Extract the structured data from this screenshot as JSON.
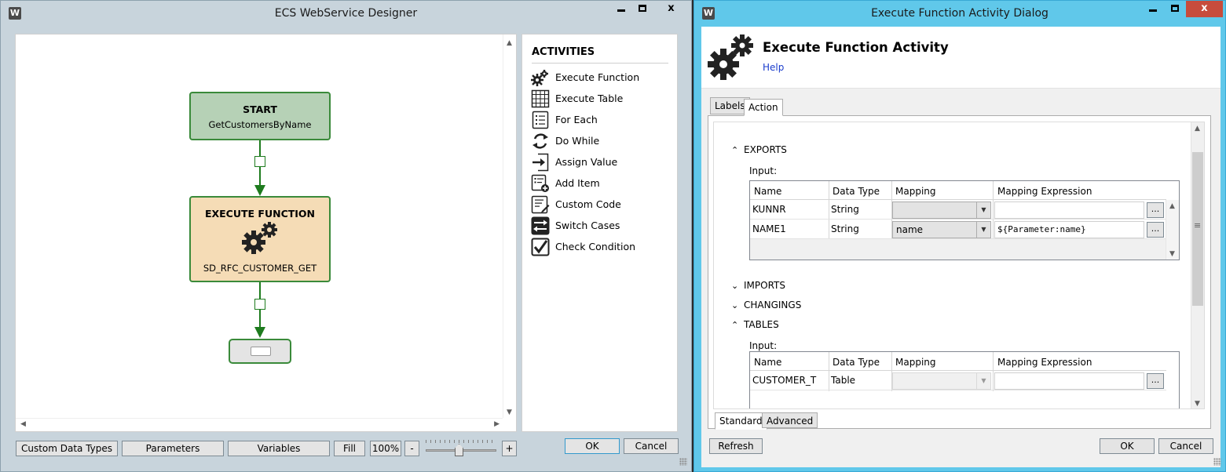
{
  "designer": {
    "title": "ECS WebService Designer",
    "app_icon": "W",
    "caption": {
      "min": "",
      "max": "",
      "close": "x"
    },
    "nodes": {
      "start": {
        "title": "START",
        "subtitle": "GetCustomersByName"
      },
      "execute": {
        "title": "EXECUTE FUNCTION",
        "subtitle": "SD_RFC_CUSTOMER_GET"
      }
    },
    "activities": {
      "header": "ACTIVITIES",
      "items": [
        {
          "label": "Execute Function",
          "icon": "gears-icon"
        },
        {
          "label": "Execute Table",
          "icon": "table-grid-icon"
        },
        {
          "label": "For Each",
          "icon": "list-icon"
        },
        {
          "label": "Do While",
          "icon": "loop-icon"
        },
        {
          "label": "Assign Value",
          "icon": "assign-arrow-icon"
        },
        {
          "label": "Add Item",
          "icon": "add-item-icon"
        },
        {
          "label": "Custom Code",
          "icon": "code-icon"
        },
        {
          "label": "Switch Cases",
          "icon": "switch-icon"
        },
        {
          "label": "Check Condition",
          "icon": "checkbox-icon"
        }
      ]
    },
    "toolbar": {
      "custom_data_types": "Custom Data Types",
      "parameters": "Parameters",
      "variables": "Variables",
      "fill": "Fill",
      "zoom": "100%",
      "zoom_out": "-",
      "zoom_in": "+"
    },
    "ok": "OK",
    "cancel": "Cancel"
  },
  "dialog": {
    "title": "Execute Function Activity Dialog",
    "app_icon": "W",
    "caption": {
      "min": "",
      "max": "",
      "close": "x"
    },
    "heading": "Execute Function Activity",
    "help": "Help",
    "tabs": {
      "labels": "Labels",
      "action": "Action"
    },
    "sections": {
      "exports": "EXPORTS",
      "imports": "IMPORTS",
      "changings": "CHANGINGS",
      "tables": "TABLES"
    },
    "input_label": "Input:",
    "columns": [
      "Name",
      "Data Type",
      "Mapping",
      "Mapping Expression"
    ],
    "exports_rows": [
      {
        "name": "KUNNR",
        "type": "String",
        "mapping": "",
        "expression": ""
      },
      {
        "name": "NAME1",
        "type": "String",
        "mapping": "name",
        "expression": "${Parameter:name}"
      }
    ],
    "tables_rows": [
      {
        "name": "CUSTOMER_T",
        "type": "Table",
        "mapping": "",
        "expression": ""
      }
    ],
    "ellipsis": "...",
    "bottom_tabs": {
      "standard": "Standard",
      "advanced": "Advanced"
    },
    "refresh": "Refresh",
    "ok": "OK",
    "cancel": "Cancel"
  },
  "colors": {
    "designer_frame": "#c8d4dc",
    "dialog_frame": "#60c8ea",
    "node_green": "#b6d1b6",
    "node_orange": "#f5dcb6",
    "connector": "#1e7b1e",
    "close_red": "#c74c3c",
    "help_link": "#1a3ccc"
  }
}
